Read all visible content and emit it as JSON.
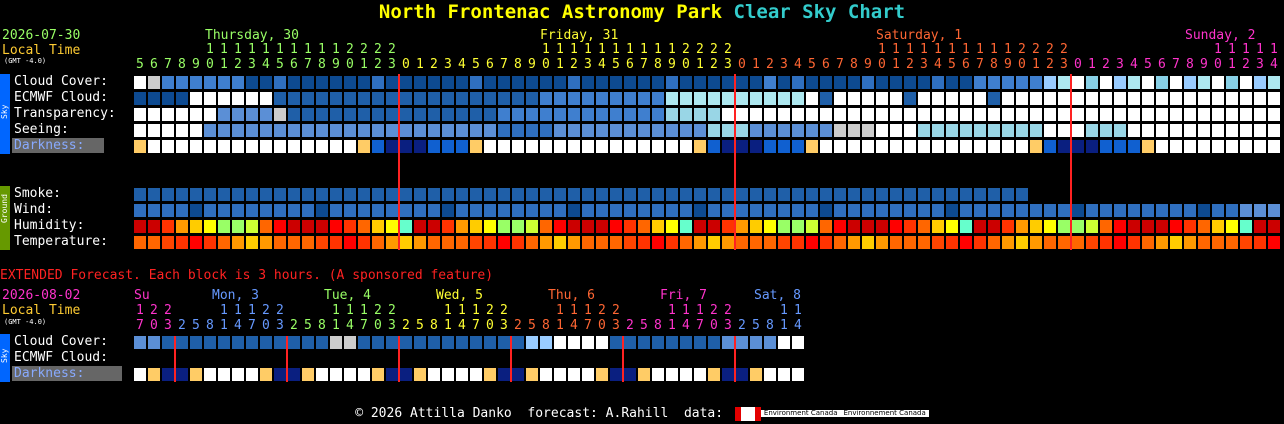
{
  "header": {
    "title_main": "North Frontenac Astronomy Park",
    "title_accent": "Clear Sky Chart",
    "date": "2026-07-30",
    "local_time": "Local Time",
    "gmt": "(GMT -4.0)"
  },
  "days": [
    {
      "label": "Thursday, 30",
      "color": "#99ff66"
    },
    {
      "label": "Friday, 31",
      "color": "#ffff33"
    },
    {
      "label": "Saturday, 1",
      "color": "#ff6633"
    },
    {
      "label": "Sunday, 2",
      "color": "#ff33cc"
    }
  ],
  "hour_colors": {
    "thu": "#99ff66",
    "fri": "#ffff33",
    "sat": "#ff6633",
    "sun": "#ff33cc"
  },
  "hours": [
    5,
    6,
    7,
    8,
    9,
    10,
    11,
    12,
    13,
    14,
    15,
    16,
    17,
    18,
    19,
    20,
    21,
    22,
    23,
    0,
    1,
    2,
    3,
    4,
    5,
    6,
    7,
    8,
    9,
    10,
    11,
    12,
    13,
    14,
    15,
    16,
    17,
    18,
    19,
    20,
    21,
    22,
    23,
    0,
    1,
    2,
    3,
    4,
    5,
    6,
    7,
    8,
    9,
    10,
    11,
    12,
    13,
    14,
    15,
    16,
    17,
    18,
    19,
    20,
    21,
    22,
    23,
    0,
    1,
    2,
    3,
    4,
    5,
    6,
    7,
    8,
    9,
    10,
    11,
    12,
    13,
    14
  ],
  "sky_rows": {
    "cloud_cover": "Cloud Cover:",
    "ecmwf_cloud": "ECMWF Cloud:",
    "transparency": "Transparency:",
    "seeing": "Seeing:",
    "darkness": "Darkness:"
  },
  "ground_rows": {
    "smoke": "Smoke:",
    "wind": "Wind:",
    "humidity": "Humidity:",
    "temperature": "Temperature:"
  },
  "sidebar": {
    "sky": "Sky",
    "ground": "Ground"
  },
  "extended": {
    "notice": "EXTENDED Forecast. Each block is 3 hours. (A sponsored feature)",
    "date": "2026-08-02",
    "local_time": "Local Time",
    "gmt": "(GMT -4.0)",
    "days": [
      {
        "label": "Su",
        "color": "#ff33cc"
      },
      {
        "label": "Mon, 3",
        "color": "#6699ff"
      },
      {
        "label": "Tue, 4",
        "color": "#99ff66"
      },
      {
        "label": "Wed, 5",
        "color": "#ffff33"
      },
      {
        "label": "Thu, 6",
        "color": "#ff6633"
      },
      {
        "label": "Fri, 7",
        "color": "#ff33cc"
      },
      {
        "label": "Sat, 8",
        "color": "#6699ff"
      }
    ],
    "hours": [
      17,
      20,
      23,
      2,
      5,
      8,
      11,
      14,
      17,
      20,
      23,
      2,
      5,
      8,
      11,
      14,
      17,
      20,
      23,
      2,
      5,
      8,
      11,
      14,
      17,
      20,
      23,
      2,
      5,
      8,
      11,
      14,
      17,
      20,
      23,
      2,
      5,
      8,
      11,
      14,
      17,
      20,
      23,
      2,
      5,
      8,
      11,
      14
    ],
    "cloud_cover": "Cloud Cover:",
    "ecmwf_cloud": "ECMWF Cloud:",
    "darkness": "Darkness:"
  },
  "footer": {
    "copyright": "© 2026 Attilla Danko",
    "forecast": "forecast: A.Rahill",
    "data": "data:",
    "agency_en": "Environment Canada",
    "agency_fr": "Environnement Canada"
  },
  "chart_data": {
    "type": "heatmap",
    "title": "North Frontenac Astronomy Park Clear Sky Chart",
    "series": [
      {
        "name": "Cloud Cover:",
        "values": [
          "w",
          "w",
          "l",
          "m",
          "m",
          "m",
          "d",
          "d",
          "d",
          "d",
          "d",
          "d",
          "d",
          "d",
          "d",
          "d",
          "d",
          "d",
          "d",
          "d",
          "d",
          "d",
          "d",
          "d",
          "d",
          "d",
          "d",
          "d",
          "d",
          "d",
          "d",
          "d",
          "d",
          "d",
          "d",
          "d",
          "d",
          "d",
          "d",
          "d",
          "d",
          "d",
          "d",
          "d",
          "d",
          "d",
          "d",
          "d",
          "d",
          "d",
          "d",
          "d",
          "d",
          "d",
          "d",
          "d",
          "d",
          "d",
          "d",
          "d",
          "d",
          "d",
          "d",
          "m",
          "m",
          "l",
          "l",
          "l",
          "t",
          "t",
          "w",
          "t",
          "w",
          "w",
          "t",
          "t",
          "l",
          "t",
          "l",
          "t",
          "l",
          "w",
          "w",
          "w",
          "w",
          "w",
          "w",
          "w",
          "w",
          "w",
          "w",
          "w",
          "w",
          "w",
          "w",
          "w",
          "w",
          "w",
          "w",
          "w",
          "w",
          "w",
          "w",
          "w",
          "w",
          "w",
          "w",
          "w",
          "w",
          "w",
          "w",
          "w",
          "w",
          "w",
          "w",
          "w",
          "w",
          "w",
          "w",
          "w",
          "w",
          "w",
          "w",
          "w",
          "w",
          "w",
          "w",
          "w",
          "w",
          "w",
          "w",
          "w",
          "w",
          "w",
          "w",
          "w",
          "w",
          "w",
          "w",
          "w",
          "w",
          "w",
          "w",
          "w",
          "w",
          "w",
          "w",
          "w",
          "w",
          "w",
          "w",
          "w",
          "w",
          "w",
          "w",
          "w",
          "w",
          "w",
          "w",
          "w",
          "w",
          "w",
          "w",
          "w",
          "w",
          "w",
          "w",
          "w",
          "w",
          "w",
          "w",
          "w",
          "w",
          "w",
          "w",
          "w",
          "w",
          "w",
          "w",
          "w"
        ]
      }
    ]
  }
}
